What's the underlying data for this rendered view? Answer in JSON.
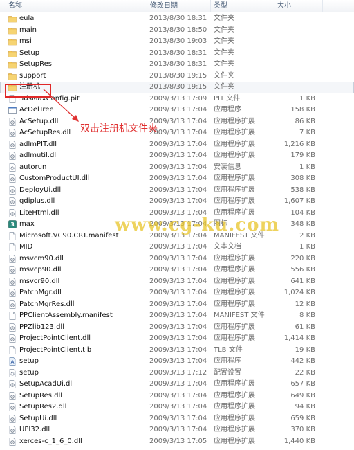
{
  "columns": {
    "name": "名称",
    "date": "修改日期",
    "type": "类型",
    "size": "大小"
  },
  "files": [
    {
      "name": "eula",
      "date": "2013/8/30 18:31",
      "type": "文件夹",
      "size": "",
      "icon": "folder-icon"
    },
    {
      "name": "main",
      "date": "2013/8/30 18:50",
      "type": "文件夹",
      "size": "",
      "icon": "folder-icon"
    },
    {
      "name": "msi",
      "date": "2013/8/30 19:03",
      "type": "文件夹",
      "size": "",
      "icon": "folder-icon"
    },
    {
      "name": "Setup",
      "date": "2013/8/30 18:31",
      "type": "文件夹",
      "size": "",
      "icon": "folder-icon"
    },
    {
      "name": "SetupRes",
      "date": "2013/8/30 18:31",
      "type": "文件夹",
      "size": "",
      "icon": "folder-icon"
    },
    {
      "name": "support",
      "date": "2013/8/30 19:15",
      "type": "文件夹",
      "size": "",
      "icon": "folder-icon"
    },
    {
      "name": "注册机",
      "date": "2013/8/30 19:15",
      "type": "文件夹",
      "size": "",
      "icon": "folder-icon",
      "selected": true
    },
    {
      "name": "3dsMaxConfig.pit",
      "date": "2009/3/13 17:09",
      "type": "PIT 文件",
      "size": "1 KB",
      "icon": "file-icon"
    },
    {
      "name": "AcDelTree",
      "date": "2009/3/13 17:04",
      "type": "应用程序",
      "size": "158 KB",
      "icon": "app-icon"
    },
    {
      "name": "AcSetup.dll",
      "date": "2009/3/13 17:04",
      "type": "应用程序扩展",
      "size": "86 KB",
      "icon": "dll-icon"
    },
    {
      "name": "AcSetupRes.dll",
      "date": "2009/3/13 17:04",
      "type": "应用程序扩展",
      "size": "7 KB",
      "icon": "dll-icon"
    },
    {
      "name": "adlmPIT.dll",
      "date": "2009/3/13 17:04",
      "type": "应用程序扩展",
      "size": "1,216 KB",
      "icon": "dll-icon"
    },
    {
      "name": "adlmutil.dll",
      "date": "2009/3/13 17:04",
      "type": "应用程序扩展",
      "size": "179 KB",
      "icon": "dll-icon"
    },
    {
      "name": "autorun",
      "date": "2009/3/13 17:04",
      "type": "安装信息",
      "size": "1 KB",
      "icon": "settings-file-icon"
    },
    {
      "name": "CustomProductUI.dll",
      "date": "2009/3/13 17:04",
      "type": "应用程序扩展",
      "size": "308 KB",
      "icon": "dll-icon"
    },
    {
      "name": "DeployUi.dll",
      "date": "2009/3/13 17:04",
      "type": "应用程序扩展",
      "size": "538 KB",
      "icon": "dll-icon"
    },
    {
      "name": "gdiplus.dll",
      "date": "2009/3/13 17:04",
      "type": "应用程序扩展",
      "size": "1,607 KB",
      "icon": "dll-icon"
    },
    {
      "name": "LiteHtml.dll",
      "date": "2009/3/13 17:04",
      "type": "应用程序扩展",
      "size": "104 KB",
      "icon": "dll-icon"
    },
    {
      "name": "max",
      "date": "2009/3/13 17:04",
      "type": "图标",
      "size": "348 KB",
      "icon": "max-icon"
    },
    {
      "name": "Microsoft.VC90.CRT.manifest",
      "date": "2009/3/13 17:04",
      "type": "MANIFEST 文件",
      "size": "2 KB",
      "icon": "file-icon"
    },
    {
      "name": "MID",
      "date": "2009/3/13 17:04",
      "type": "文本文档",
      "size": "1 KB",
      "icon": "file-icon"
    },
    {
      "name": "msvcm90.dll",
      "date": "2009/3/13 17:04",
      "type": "应用程序扩展",
      "size": "220 KB",
      "icon": "dll-icon"
    },
    {
      "name": "msvcp90.dll",
      "date": "2009/3/13 17:04",
      "type": "应用程序扩展",
      "size": "556 KB",
      "icon": "dll-icon"
    },
    {
      "name": "msvcr90.dll",
      "date": "2009/3/13 17:04",
      "type": "应用程序扩展",
      "size": "641 KB",
      "icon": "dll-icon"
    },
    {
      "name": "PatchMgr.dll",
      "date": "2009/3/13 17:04",
      "type": "应用程序扩展",
      "size": "1,024 KB",
      "icon": "dll-icon"
    },
    {
      "name": "PatchMgrRes.dll",
      "date": "2009/3/13 17:04",
      "type": "应用程序扩展",
      "size": "12 KB",
      "icon": "dll-icon"
    },
    {
      "name": "PPClientAssembly.manifest",
      "date": "2009/3/13 17:04",
      "type": "MANIFEST 文件",
      "size": "8 KB",
      "icon": "file-icon"
    },
    {
      "name": "PPZlib123.dll",
      "date": "2009/3/13 17:04",
      "type": "应用程序扩展",
      "size": "61 KB",
      "icon": "dll-icon"
    },
    {
      "name": "ProjectPointClient.dll",
      "date": "2009/3/13 17:04",
      "type": "应用程序扩展",
      "size": "1,414 KB",
      "icon": "dll-icon"
    },
    {
      "name": "ProjectPointClient.tlb",
      "date": "2009/3/13 17:04",
      "type": "TLB 文件",
      "size": "19 KB",
      "icon": "file-icon"
    },
    {
      "name": "setup",
      "date": "2009/3/13 17:04",
      "type": "应用程序",
      "size": "442 KB",
      "icon": "setup-icon"
    },
    {
      "name": "setup",
      "date": "2009/3/13 17:12",
      "type": "配置设置",
      "size": "22 KB",
      "icon": "settings-file-icon"
    },
    {
      "name": "SetupAcadUi.dll",
      "date": "2009/3/13 17:04",
      "type": "应用程序扩展",
      "size": "657 KB",
      "icon": "dll-icon"
    },
    {
      "name": "SetupRes.dll",
      "date": "2009/3/13 17:04",
      "type": "应用程序扩展",
      "size": "649 KB",
      "icon": "dll-icon"
    },
    {
      "name": "SetupRes2.dll",
      "date": "2009/3/13 17:04",
      "type": "应用程序扩展",
      "size": "94 KB",
      "icon": "dll-icon"
    },
    {
      "name": "SetupUi.dll",
      "date": "2009/3/13 17:04",
      "type": "应用程序扩展",
      "size": "659 KB",
      "icon": "dll-icon"
    },
    {
      "name": "UPI32.dll",
      "date": "2009/3/13 17:04",
      "type": "应用程序扩展",
      "size": "370 KB",
      "icon": "dll-icon"
    },
    {
      "name": "xerces-c_1_6_0.dll",
      "date": "2009/3/13 17:05",
      "type": "应用程序扩展",
      "size": "1,440 KB",
      "icon": "dll-icon"
    }
  ],
  "annotation": "双击注册机文件夹",
  "watermark": "www.cg-ku.com",
  "colors": {
    "annotation": "#e03030",
    "folder": "#e8b33c",
    "selection_border": "#c6cfdb"
  }
}
